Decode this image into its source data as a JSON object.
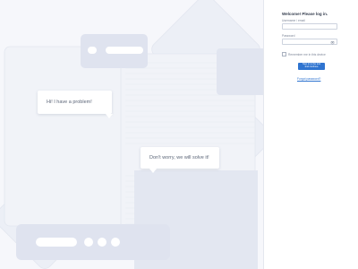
{
  "colors": {
    "background": "#f6f7fb",
    "accent": "#2f74d0",
    "panel": "#ffffff"
  },
  "illustration": {
    "bubble_problem": "Hi! I have a problem!",
    "bubble_advice": "Don't worry, we will solve it!"
  },
  "login": {
    "title": "Welcome! Please log in.",
    "username_label": "Username / email",
    "username_value": "",
    "password_label": "Password",
    "password_value": "",
    "password_icon": "eye-icon",
    "remember_label": "Remember me in this device",
    "remember_checked": false,
    "submit_label_line1": "Sign in to the tool",
    "submit_label_line2": "and continue",
    "forgot_link": "Forgot password?"
  }
}
